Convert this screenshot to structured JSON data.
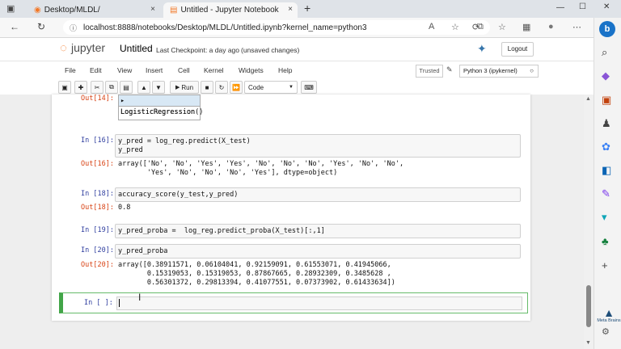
{
  "browser": {
    "tabs": [
      {
        "title": "Desktop/MLDL/",
        "close": "×"
      },
      {
        "title": "Untitled - Jupyter Notebook",
        "close": "×"
      }
    ],
    "new_tab": "+",
    "url": "localhost:8888/notebooks/Desktop/MLDL/Untitled.ipynb?kernel_name=python3",
    "window_controls": {
      "minimize": "—",
      "maximize": "☐",
      "close": "✕"
    }
  },
  "jupyter": {
    "logo_text": "jupyter",
    "notebook_name": "Untitled",
    "checkpoint": "Last Checkpoint: a day ago",
    "unsaved": "(unsaved changes)",
    "logout": "Logout",
    "menus": [
      "File",
      "Edit",
      "View",
      "Insert",
      "Cell",
      "Kernel",
      "Widgets",
      "Help"
    ],
    "trusted": "Trusted",
    "kernel": "Python 3 (ipykernel)",
    "run_label": "Run",
    "cell_type": "Code"
  },
  "cells": {
    "c14": {
      "out_prompt": "Out[14]:",
      "widget_header": "▸ LogisticRegression",
      "widget_body": "LogisticRegression()"
    },
    "c16": {
      "in_prompt": "In [16]:",
      "code": "y_pred = log_reg.predict(X_test)\ny_pred",
      "out_prompt": "Out[16]:",
      "output": "array(['No', 'No', 'Yes', 'Yes', 'No', 'No', 'No', 'Yes', 'No', 'No',\n       'Yes', 'No', 'No', 'No', 'Yes'], dtype=object)"
    },
    "c18": {
      "in_prompt": "In [18]:",
      "code": "accuracy_score(y_test,y_pred)",
      "out_prompt": "Out[18]:",
      "output": "0.8"
    },
    "c19": {
      "in_prompt": "In [19]:",
      "code": "y_pred_proba =  log_reg.predict_proba(X_test)[:,1]"
    },
    "c20": {
      "in_prompt": "In [20]:",
      "code": "y_pred_proba",
      "out_prompt": "Out[20]:",
      "output": "array([0.38911571, 0.06104041, 0.92159091, 0.61553071, 0.41945066,\n       0.15319053, 0.15319053, 0.87867665, 0.28932309, 0.3485628 ,\n       0.56301372, 0.29813394, 0.41077551, 0.07373902, 0.61433634])"
    },
    "empty": {
      "in_prompt": "In [ ]:"
    }
  },
  "watermark": "Meta Brains"
}
